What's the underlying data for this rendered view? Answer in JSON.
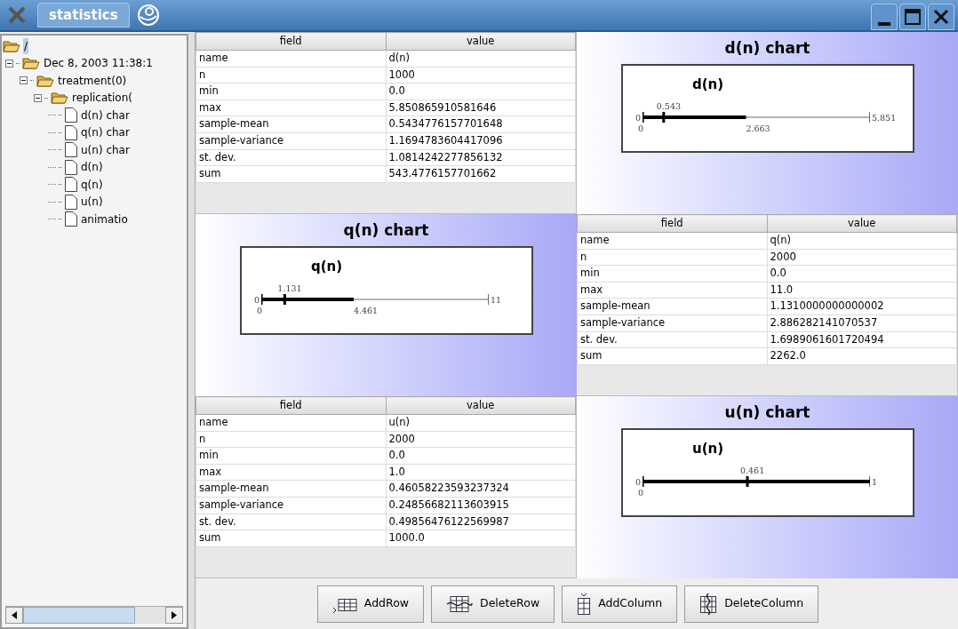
{
  "window": {
    "title": "statistics"
  },
  "tree": {
    "label": "/",
    "selected": true,
    "children": [
      {
        "label": "Dec 8, 2003 11:38:1",
        "selected": false,
        "expanded": true,
        "children": [
          {
            "label": "treatment(0)",
            "selected": false,
            "expanded": true,
            "children": [
              {
                "label": "replication(",
                "selected": false,
                "expanded": true,
                "children": [
                  {
                    "label": "d(n) char",
                    "selected": false
                  },
                  {
                    "label": "q(n) char",
                    "selected": false
                  },
                  {
                    "label": "u(n) char",
                    "selected": false
                  },
                  {
                    "label": "d(n)",
                    "selected": false
                  },
                  {
                    "label": "q(n)",
                    "selected": false
                  },
                  {
                    "label": "u(n)",
                    "selected": false
                  },
                  {
                    "label": "animatio",
                    "selected": false
                  }
                ]
              }
            ]
          }
        ]
      }
    ]
  },
  "panels": [
    {
      "kind": "table",
      "columns": [
        "field",
        "value"
      ],
      "rows": [
        [
          "name",
          "d(n)"
        ],
        [
          "n",
          "1000"
        ],
        [
          "min",
          "0.0"
        ],
        [
          "max",
          "5.850865910581646"
        ],
        [
          "sample-mean",
          "0.5434776157701648"
        ],
        [
          "sample-variance",
          "1.1694783604417096"
        ],
        [
          "st. dev.",
          "1.0814242277856132"
        ],
        [
          "sum",
          "543.4776157701662"
        ]
      ]
    },
    {
      "kind": "chart",
      "title": "d(n) chart",
      "subtitle": "d(n)",
      "start_label": "0",
      "min_label": "0",
      "max_label": "5.851",
      "mean": {
        "label": "0.543",
        "level": 0.093
      },
      "bar": {
        "label": "2.663",
        "level": 0.455
      }
    },
    {
      "kind": "chart",
      "title": "q(n) chart",
      "subtitle": "q(n)",
      "start_label": "0",
      "min_label": "0",
      "max_label": "11",
      "mean": {
        "label": "1.131",
        "level": 0.103
      },
      "bar": {
        "label": "4.461",
        "level": 0.406
      }
    },
    {
      "kind": "table",
      "columns": [
        "field",
        "value"
      ],
      "rows": [
        [
          "name",
          "q(n)"
        ],
        [
          "n",
          "2000"
        ],
        [
          "min",
          "0.0"
        ],
        [
          "max",
          "11.0"
        ],
        [
          "sample-mean",
          "1.1310000000000002"
        ],
        [
          "sample-variance",
          "2.886282141070537"
        ],
        [
          "st. dev.",
          "1.6989061601720494"
        ],
        [
          "sum",
          "2262.0"
        ]
      ]
    },
    {
      "kind": "table",
      "columns": [
        "field",
        "value"
      ],
      "rows": [
        [
          "name",
          "u(n)"
        ],
        [
          "n",
          "2000"
        ],
        [
          "min",
          "0.0"
        ],
        [
          "max",
          "1.0"
        ],
        [
          "sample-mean",
          "0.46058223593237324"
        ],
        [
          "sample-variance",
          "0.24856682113603915"
        ],
        [
          "st. dev.",
          "0.49856476122569987"
        ],
        [
          "sum",
          "1000.0"
        ]
      ]
    },
    {
      "kind": "chart",
      "title": "u(n) chart",
      "subtitle": "u(n)",
      "start_label": "0",
      "min_label": "0",
      "max_label": "1",
      "mean": {
        "label": "0.461",
        "level": 0.461
      },
      "bar": {
        "level": 1.0
      }
    }
  ],
  "buttons": [
    {
      "kind": "add-row",
      "label": "AddRow"
    },
    {
      "kind": "delete-row",
      "label": "DeleteRow"
    },
    {
      "kind": "add-column",
      "label": "AddColumn"
    },
    {
      "kind": "delete-column",
      "label": "DeleteColumn"
    }
  ]
}
